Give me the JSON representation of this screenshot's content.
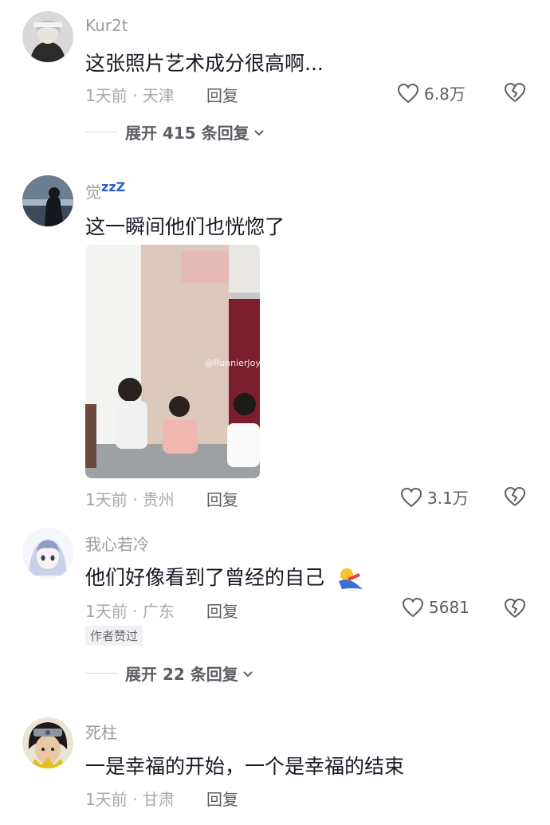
{
  "comments": [
    {
      "username": "Kur2t",
      "text": "这张照片艺术成分很高啊...",
      "time": "1天前",
      "location": "天津",
      "reply_label": "回复",
      "likes": "6.8万",
      "expand_label": "展开 415 条回复"
    },
    {
      "username": "觉",
      "username_emoji": "zzZ",
      "text": "这一瞬间他们也恍惚了",
      "image_watermark": "@RunnierJoy",
      "time": "1天前",
      "location": "贵州",
      "reply_label": "回复",
      "likes": "3.1万"
    },
    {
      "username": "我心若冷",
      "text": "他们好像看到了曾经的自己",
      "time": "1天前",
      "location": "广东",
      "reply_label": "回复",
      "likes": "5681",
      "author_badge": "作者赞过",
      "expand_label": "展开 22 条回复"
    },
    {
      "username": "死柱",
      "text": "一是幸福的开始，一个是幸福的结束",
      "time": "1天前",
      "location": "甘肃",
      "reply_label": "回复"
    }
  ],
  "separator": " · ",
  "icons": {
    "like": "heart-outline-icon",
    "dislike": "broken-heart-icon",
    "expand": "chevron-down-icon"
  }
}
